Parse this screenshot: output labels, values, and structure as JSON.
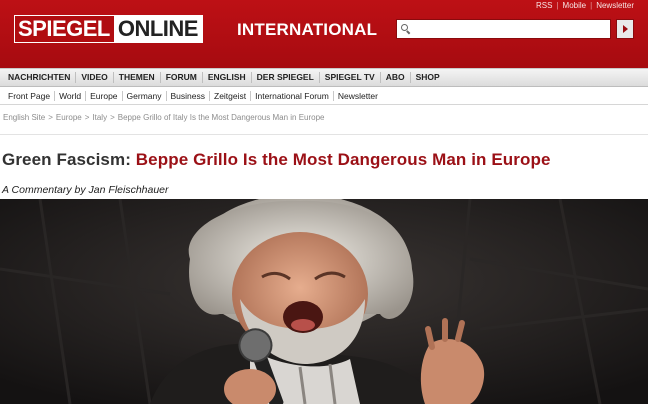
{
  "header": {
    "util_links": [
      "RSS",
      "Mobile",
      "Newsletter"
    ],
    "logo_part1": "SPIEGEL",
    "logo_part2": "ONLINE",
    "edition": "INTERNATIONAL",
    "search": {
      "value": "",
      "placeholder": ""
    },
    "search_button_icon": "arrow-right-icon",
    "brand_color": "#b00d11"
  },
  "mainnav": [
    "NACHRICHTEN",
    "VIDEO",
    "THEMEN",
    "FORUM",
    "ENGLISH",
    "DER SPIEGEL",
    "SPIEGEL TV",
    "ABO",
    "SHOP"
  ],
  "subnav": [
    "Front Page",
    "World",
    "Europe",
    "Germany",
    "Business",
    "Zeitgeist",
    "International Forum",
    "Newsletter"
  ],
  "breadcrumb": {
    "items": [
      "English Site",
      "Europe",
      "Italy"
    ],
    "separator": ">",
    "current": "Beppe Grillo of Italy Is the Most Dangerous Man in Europe"
  },
  "article": {
    "kicker": "Green Fascism:",
    "title": "Beppe Grillo Is the Most Dangerous Man in Europe",
    "byline": "A Commentary by Jan Fleischhauer",
    "title_color": "#9b1016"
  }
}
